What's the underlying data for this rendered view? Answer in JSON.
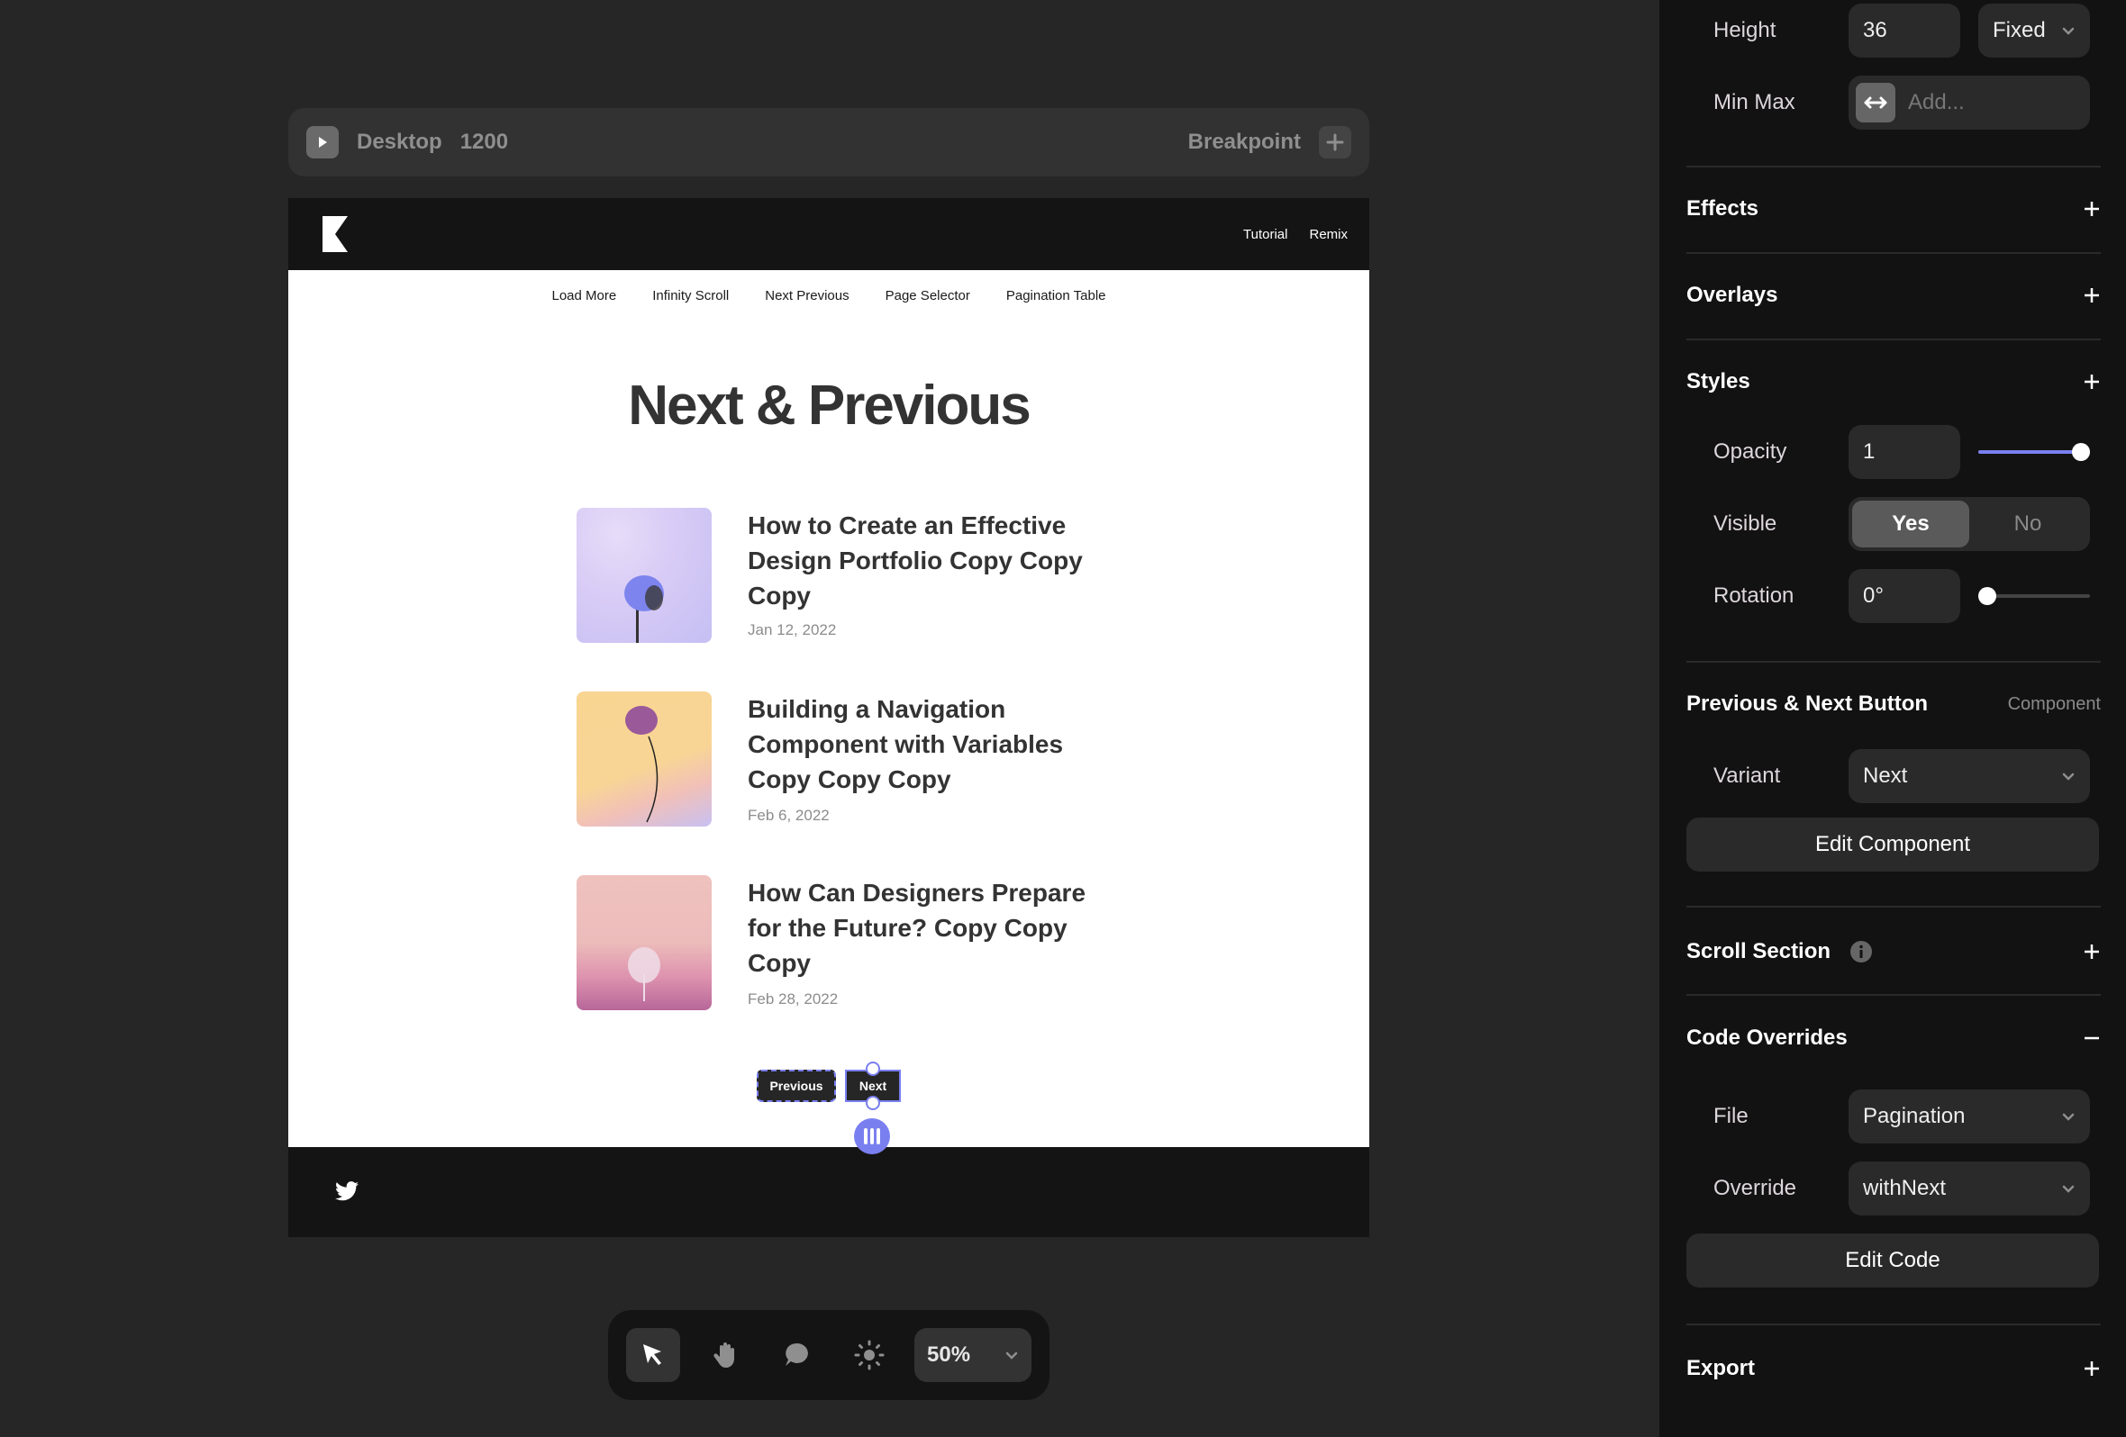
{
  "breakpoint_bar": {
    "device": "Desktop",
    "width": "1200",
    "breakpoint_label": "Breakpoint"
  },
  "site": {
    "header_links": [
      "Tutorial",
      "Remix"
    ],
    "nav": [
      "Load More",
      "Infinity Scroll",
      "Next Previous",
      "Page Selector",
      "Pagination Table"
    ],
    "title": "Next & Previous",
    "posts": [
      {
        "title": "How to Create an Effective Design Portfolio Copy Copy Copy",
        "date": "Jan 12, 2022",
        "thumb": "purple-tree"
      },
      {
        "title": "Building a Navigation Component with Variables Copy Copy Copy",
        "date": "Feb 6, 2022",
        "thumb": "yellow-branch"
      },
      {
        "title": "How Can Designers Prepare for the Future? Copy Copy Copy",
        "date": "Feb 28, 2022",
        "thumb": "pink-tree"
      }
    ],
    "pager": {
      "previous": "Previous",
      "next": "Next"
    },
    "footer_icon": "twitter-icon"
  },
  "toolbar": {
    "tools": [
      "select-tool",
      "hand-tool",
      "comment-tool",
      "theme-tool"
    ],
    "zoom": "50%"
  },
  "panel": {
    "height": {
      "label": "Height",
      "value": "36",
      "mode": "Fixed"
    },
    "minmax": {
      "label": "Min Max",
      "placeholder": "Add..."
    },
    "sections": {
      "effects": "Effects",
      "overlays": "Overlays",
      "styles": "Styles",
      "component": "Previous & Next Button",
      "component_tag": "Component",
      "scroll": "Scroll Section",
      "code_overrides": "Code Overrides",
      "export": "Export"
    },
    "opacity": {
      "label": "Opacity",
      "value": "1",
      "slider_fraction": 1.0
    },
    "visible": {
      "label": "Visible",
      "options": [
        "Yes",
        "No"
      ],
      "selected": "Yes"
    },
    "rotation": {
      "label": "Rotation",
      "value": "0°",
      "slider_fraction": 0.0
    },
    "variant": {
      "label": "Variant",
      "value": "Next"
    },
    "edit_component": "Edit Component",
    "file": {
      "label": "File",
      "value": "Pagination"
    },
    "override": {
      "label": "Override",
      "value": "withNext"
    },
    "edit_code": "Edit Code"
  },
  "colors": {
    "accent": "#7a7ff0",
    "canvas_bg": "#262626",
    "panel_bg": "#121212"
  }
}
